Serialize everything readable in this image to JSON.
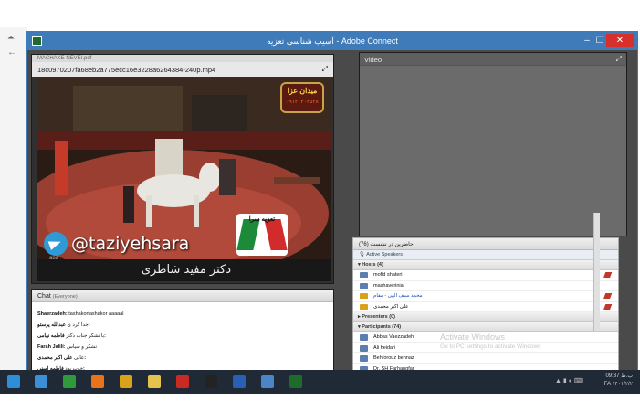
{
  "window": {
    "title": "آسیب شناسی تعزیه - Adobe Connect",
    "minimize_label": "–",
    "maximize_label": "☐",
    "close_label": "✕"
  },
  "file_pod": {
    "tab_label": "MACHAKE NEVEI.pdf",
    "file_name": "18c0970207fa68eb2a775ecc16e3228a6264384-240p.mp4",
    "fullscreen_label": "⤢",
    "watermark": "@taziyehsara",
    "watermark_sub": "apa",
    "caption": "دکتر مفید شاطری",
    "badge_top": "میدان عزا",
    "badge_bottom": "۰۹۱۲۰۳۰۳۵۲۸",
    "logo_text": "تعزیه سرا"
  },
  "chat": {
    "title": "Chat",
    "scope": "(Everyone)",
    "messages": [
      {
        "name": "Shaerzadeh:",
        "text": "tashakortashakor  aaaaal"
      },
      {
        "name": "عبدالله پرستو:",
        "text": "جدا کرد ی"
      },
      {
        "name": "فاطمه نهامی:",
        "text": "با تشکر جناب دکتر"
      },
      {
        "name": "Farah Jalili:",
        "text": "تشکر و سپاس"
      },
      {
        "name": "علی اکبر محمدی:",
        "text": "عالی"
      },
      {
        "name": "فاطمه امینی:",
        "text": "خوب بود"
      }
    ]
  },
  "video_pod": {
    "title": "Video",
    "fullscreen_label": "⤢"
  },
  "attendees": {
    "title": "حاضرین در نشست (76)",
    "active_speakers": "Active Speakers",
    "hosts_label": "Hosts (4)",
    "hosts": [
      {
        "name": "mofid shateri",
        "blue": false
      },
      {
        "name": "mashaverinia",
        "blue": false
      },
      {
        "name": "محمد سیف الهی - مقام",
        "blue": true
      },
      {
        "name": "علی اکبر محمدی",
        "blue": false
      }
    ],
    "presenters_label": "Presenters (0)",
    "participants_label": "Participants (74)",
    "participants": [
      {
        "name": "Abbas Vaezzadeh"
      },
      {
        "name": "Ali heidari"
      },
      {
        "name": "Behforouz behnaz"
      },
      {
        "name": "Dr. SH Farhangfar"
      }
    ]
  },
  "activation": {
    "line1": "Activate Windows",
    "line2": "Go to PC settings to activate Windows"
  },
  "taskbar": {
    "time": "09:37 ب.ظ",
    "date": "FA  ۱۴۰۱/۲/۲",
    "apps": [
      {
        "name": "ie",
        "color": "#3a8fd6"
      },
      {
        "name": "explorer-green",
        "color": "#2e9a3c"
      },
      {
        "name": "firefox",
        "color": "#e8731a"
      },
      {
        "name": "chrome",
        "color": "#d9a21a"
      },
      {
        "name": "folder",
        "color": "#e6c34c"
      },
      {
        "name": "acrobat",
        "color": "#c92a22"
      },
      {
        "name": "player",
        "color": "#232323"
      },
      {
        "name": "word",
        "color": "#2b5fb3"
      },
      {
        "name": "viewer",
        "color": "#4a86c7"
      },
      {
        "name": "adobe-connect",
        "color": "#1e6b2c"
      }
    ]
  }
}
